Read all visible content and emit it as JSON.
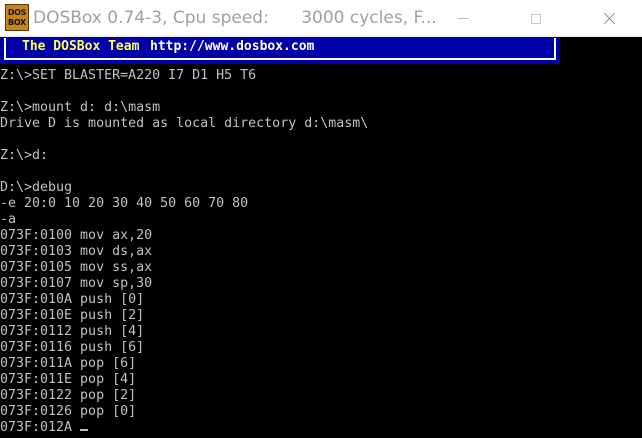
{
  "window": {
    "title": "DOSBox 0.74-3, Cpu speed:      3000 cycles, F...",
    "icon_line1": "DOS",
    "icon_line2": "BOX",
    "icon_name": "dosbox-icon",
    "buttons": [
      "minimize",
      "maximize",
      "close"
    ]
  },
  "banner": {
    "team_text": "The DOSBox Team",
    "url_text": "http://www.dosbox.com",
    "team_color": "#ffff54",
    "url_color": "#ffffff",
    "background_color": "#0000a8"
  },
  "console": {
    "lines": [
      "Z:\\>SET BLASTER=A220 I7 D1 H5 T6",
      "",
      "Z:\\>mount d: d:\\masm",
      "Drive D is mounted as local directory d:\\masm\\",
      "",
      "Z:\\>d:",
      "",
      "D:\\>debug",
      "-e 20:0 10 20 30 40 50 60 70 80",
      "-a",
      "073F:0100 mov ax,20",
      "073F:0103 mov ds,ax",
      "073F:0105 mov ss,ax",
      "073F:0107 mov sp,30",
      "073F:010A push [0]",
      "073F:010E push [2]",
      "073F:0112 push [4]",
      "073F:0116 push [6]",
      "073F:011A pop [6]",
      "073F:011E pop [4]",
      "073F:0122 pop [2]",
      "073F:0126 pop [0]",
      "073F:012A "
    ],
    "text_color": "#c0c0c0",
    "background_color": "#000000"
  }
}
